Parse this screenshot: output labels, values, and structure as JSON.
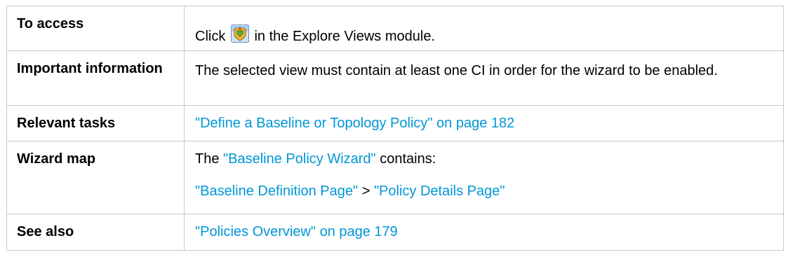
{
  "rows": [
    {
      "label": "To access",
      "content": {
        "before": "Click",
        "icon": "baseline-policy-wizard-icon",
        "after": "in the Explore Views module."
      }
    },
    {
      "label": "Important information",
      "content": {
        "text": "The selected view must contain at least one CI in order for the wizard to be enabled."
      }
    },
    {
      "label": "Relevant tasks",
      "content": {
        "link": "\"Define a Baseline or Topology Policy\" on page 182"
      }
    },
    {
      "label": "Wizard map",
      "content": {
        "line1_before": "The",
        "line1_link": "\"Baseline Policy Wizard\"",
        "line1_after": "contains:",
        "line2_link1": "\"Baseline Definition Page\"",
        "line2_sep": ">",
        "line2_link2": "\"Policy Details Page\""
      }
    },
    {
      "label": "See also",
      "content": {
        "link": "\"Policies Overview\" on page 179"
      }
    }
  ],
  "colors": {
    "link": "#0096d6",
    "border": "#c8c8c8"
  }
}
